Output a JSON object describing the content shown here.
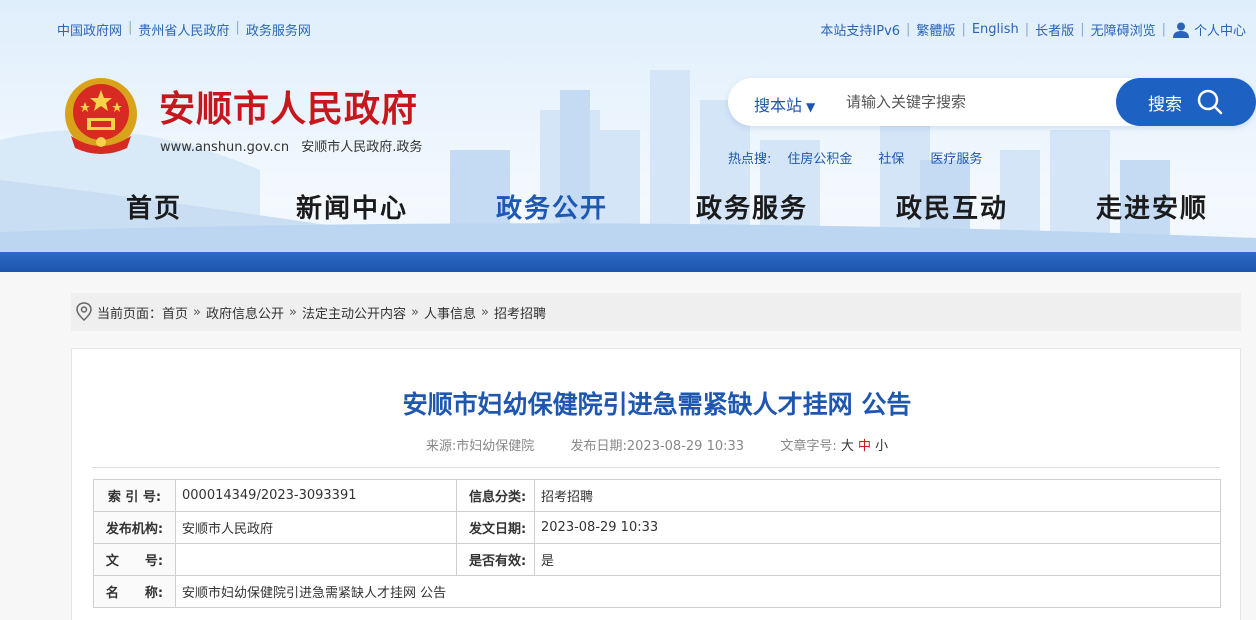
{
  "top_links_left": [
    "中国政府网",
    "贵州省人民政府",
    "政务服务网"
  ],
  "top_links_right": [
    "本站支持IPv6",
    "繁體版",
    "English",
    "长者版",
    "无障碍浏览",
    "个人中心"
  ],
  "site": {
    "title": "安顺市人民政府",
    "url": "www.anshun.gov.cn",
    "subtitle": "安顺市人民政府.政务"
  },
  "search": {
    "scope": "搜本站",
    "placeholder": "请输入关键字搜索",
    "button_label": "搜索"
  },
  "hot_search": {
    "label": "热点搜:",
    "items": [
      "住房公积金",
      "社保",
      "医疗服务"
    ]
  },
  "nav": {
    "items": [
      "首页",
      "新闻中心",
      "政务公开",
      "政务服务",
      "政民互动",
      "走进安顺"
    ],
    "active": "政务公开"
  },
  "breadcrumb": {
    "prefix": "当前页面：",
    "items": [
      "首页",
      "政府信息公开",
      "法定主动公开内容",
      "人事信息",
      "招考招聘"
    ],
    "separator": "»"
  },
  "article": {
    "title": "安顺市妇幼保健院引进急需紧缺人才挂网 公告",
    "source_label": "来源:",
    "source": "市妇幼保健院",
    "date_label": "发布日期:",
    "date": "2023-08-29 10:33",
    "font_size_label": "文章字号:",
    "font_sizes": [
      "大",
      "中",
      "小"
    ]
  },
  "info_table": {
    "index_label": "索 引 号:",
    "index_value": "000014349/2023-3093391",
    "category_label": "信息分类:",
    "category_value": "招考招聘",
    "publisher_label": "发布机构:",
    "publisher_value": "安顺市人民政府",
    "issue_date_label": "发文日期:",
    "issue_date_value": "2023-08-29 10:33",
    "doc_no_label": "文　　号:",
    "doc_no_value": "",
    "valid_label": "是否有效:",
    "valid_value": "是",
    "name_label": "名　　称:",
    "name_value": "安顺市妇幼保健院引进急需紧缺人才挂网 公告"
  },
  "colors": {
    "brand_red": "#c8161d",
    "brand_blue": "#1d62c2",
    "nav_active": "#1d58b5"
  }
}
